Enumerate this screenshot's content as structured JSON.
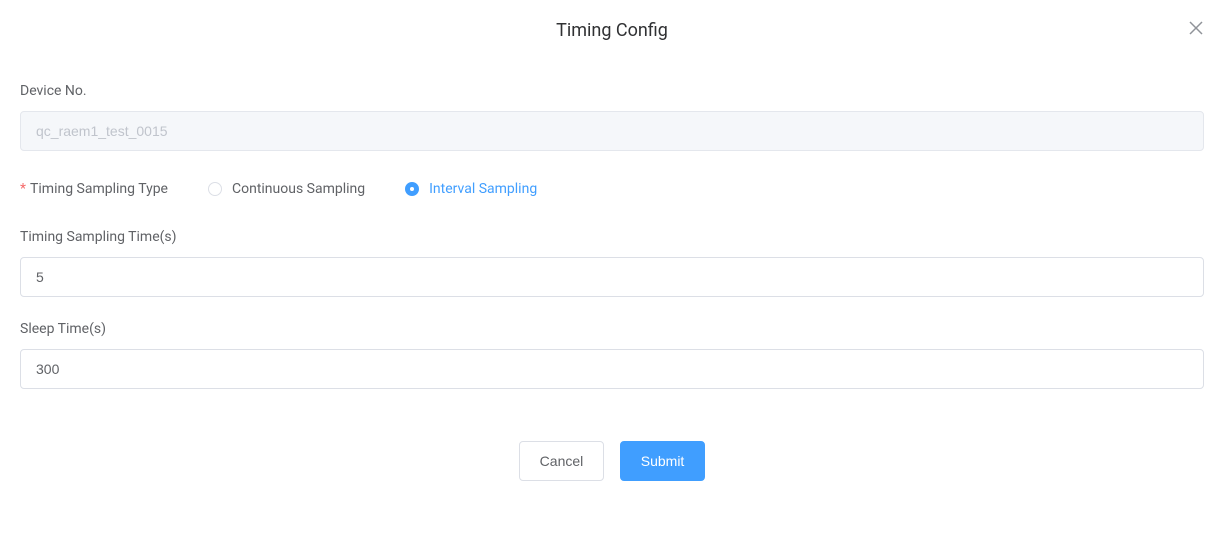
{
  "dialog": {
    "title": "Timing Config"
  },
  "form": {
    "deviceNo": {
      "label": "Device No.",
      "value": "qc_raem1_test_0015"
    },
    "samplingType": {
      "label": "Timing Sampling Type",
      "options": {
        "continuous": "Continuous Sampling",
        "interval": "Interval Sampling"
      },
      "selected": "interval"
    },
    "samplingTime": {
      "label": "Timing Sampling Time(s)",
      "value": "5"
    },
    "sleepTime": {
      "label": "Sleep Time(s)",
      "value": "300"
    }
  },
  "footer": {
    "cancel": "Cancel",
    "submit": "Submit"
  }
}
